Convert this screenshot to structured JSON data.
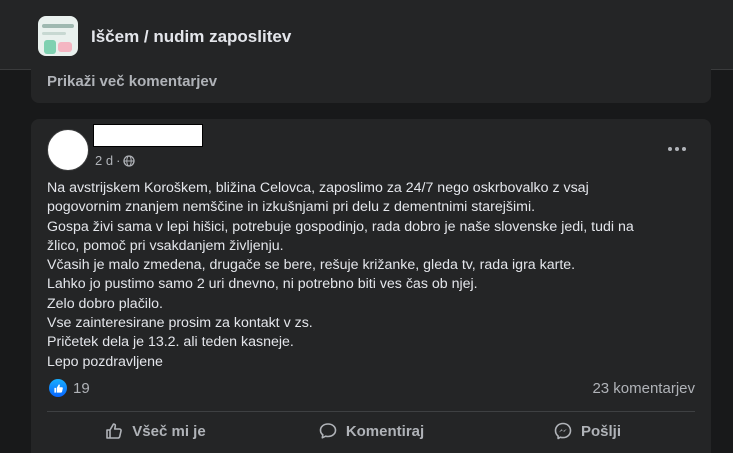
{
  "header": {
    "group_title": "Iščem / nudim zaposlitev",
    "thumb_icon": "group-cover-thumbnail"
  },
  "previous_post": {
    "more_comments_label": "Prikaži več komentarjev"
  },
  "post": {
    "author_name": "",
    "timestamp": "2 d",
    "separator": "·",
    "privacy_icon": "globe-icon",
    "menu_icon": "more-options-icon",
    "lines": [
      "Na avstrijskem Koroškem, bližina Celovca,  zaposlimo za 24/7 nego oskrbovalko z vsaj",
      "pogovornim znanjem nemščine in izkušnjami pri delu z dementnimi starejšimi.",
      "Gospa živi sama v lepi hišici, potrebuje gospodinjo, rada dobro je naše slovenske jedi, tudi na",
      "žlico, pomoč pri vsakdanjem življenju.",
      "Včasih je malo zmedena, drugače se bere, rešuje križanke, gleda tv, rada igra karte.",
      "Lahko jo pustimo samo 2 uri dnevno, ni potrebno biti ves čas ob njej.",
      "Zelo dobro plačilo.",
      "Vse zainteresirane prosim za kontakt  v zs.",
      "Pričetek dela je 13.2. ali teden kasneje.",
      "Lepo pozdravljene"
    ],
    "reaction_count": "19",
    "comment_count": "23 komentarjev",
    "actions": {
      "like": "Všeč mi je",
      "comment": "Komentiraj",
      "share": "Pošlji"
    }
  },
  "colors": {
    "background": "#18191a",
    "card": "#242526",
    "text_primary": "#e4e6eb",
    "text_secondary": "#b0b3b8",
    "like_blue": "#0866ff"
  }
}
